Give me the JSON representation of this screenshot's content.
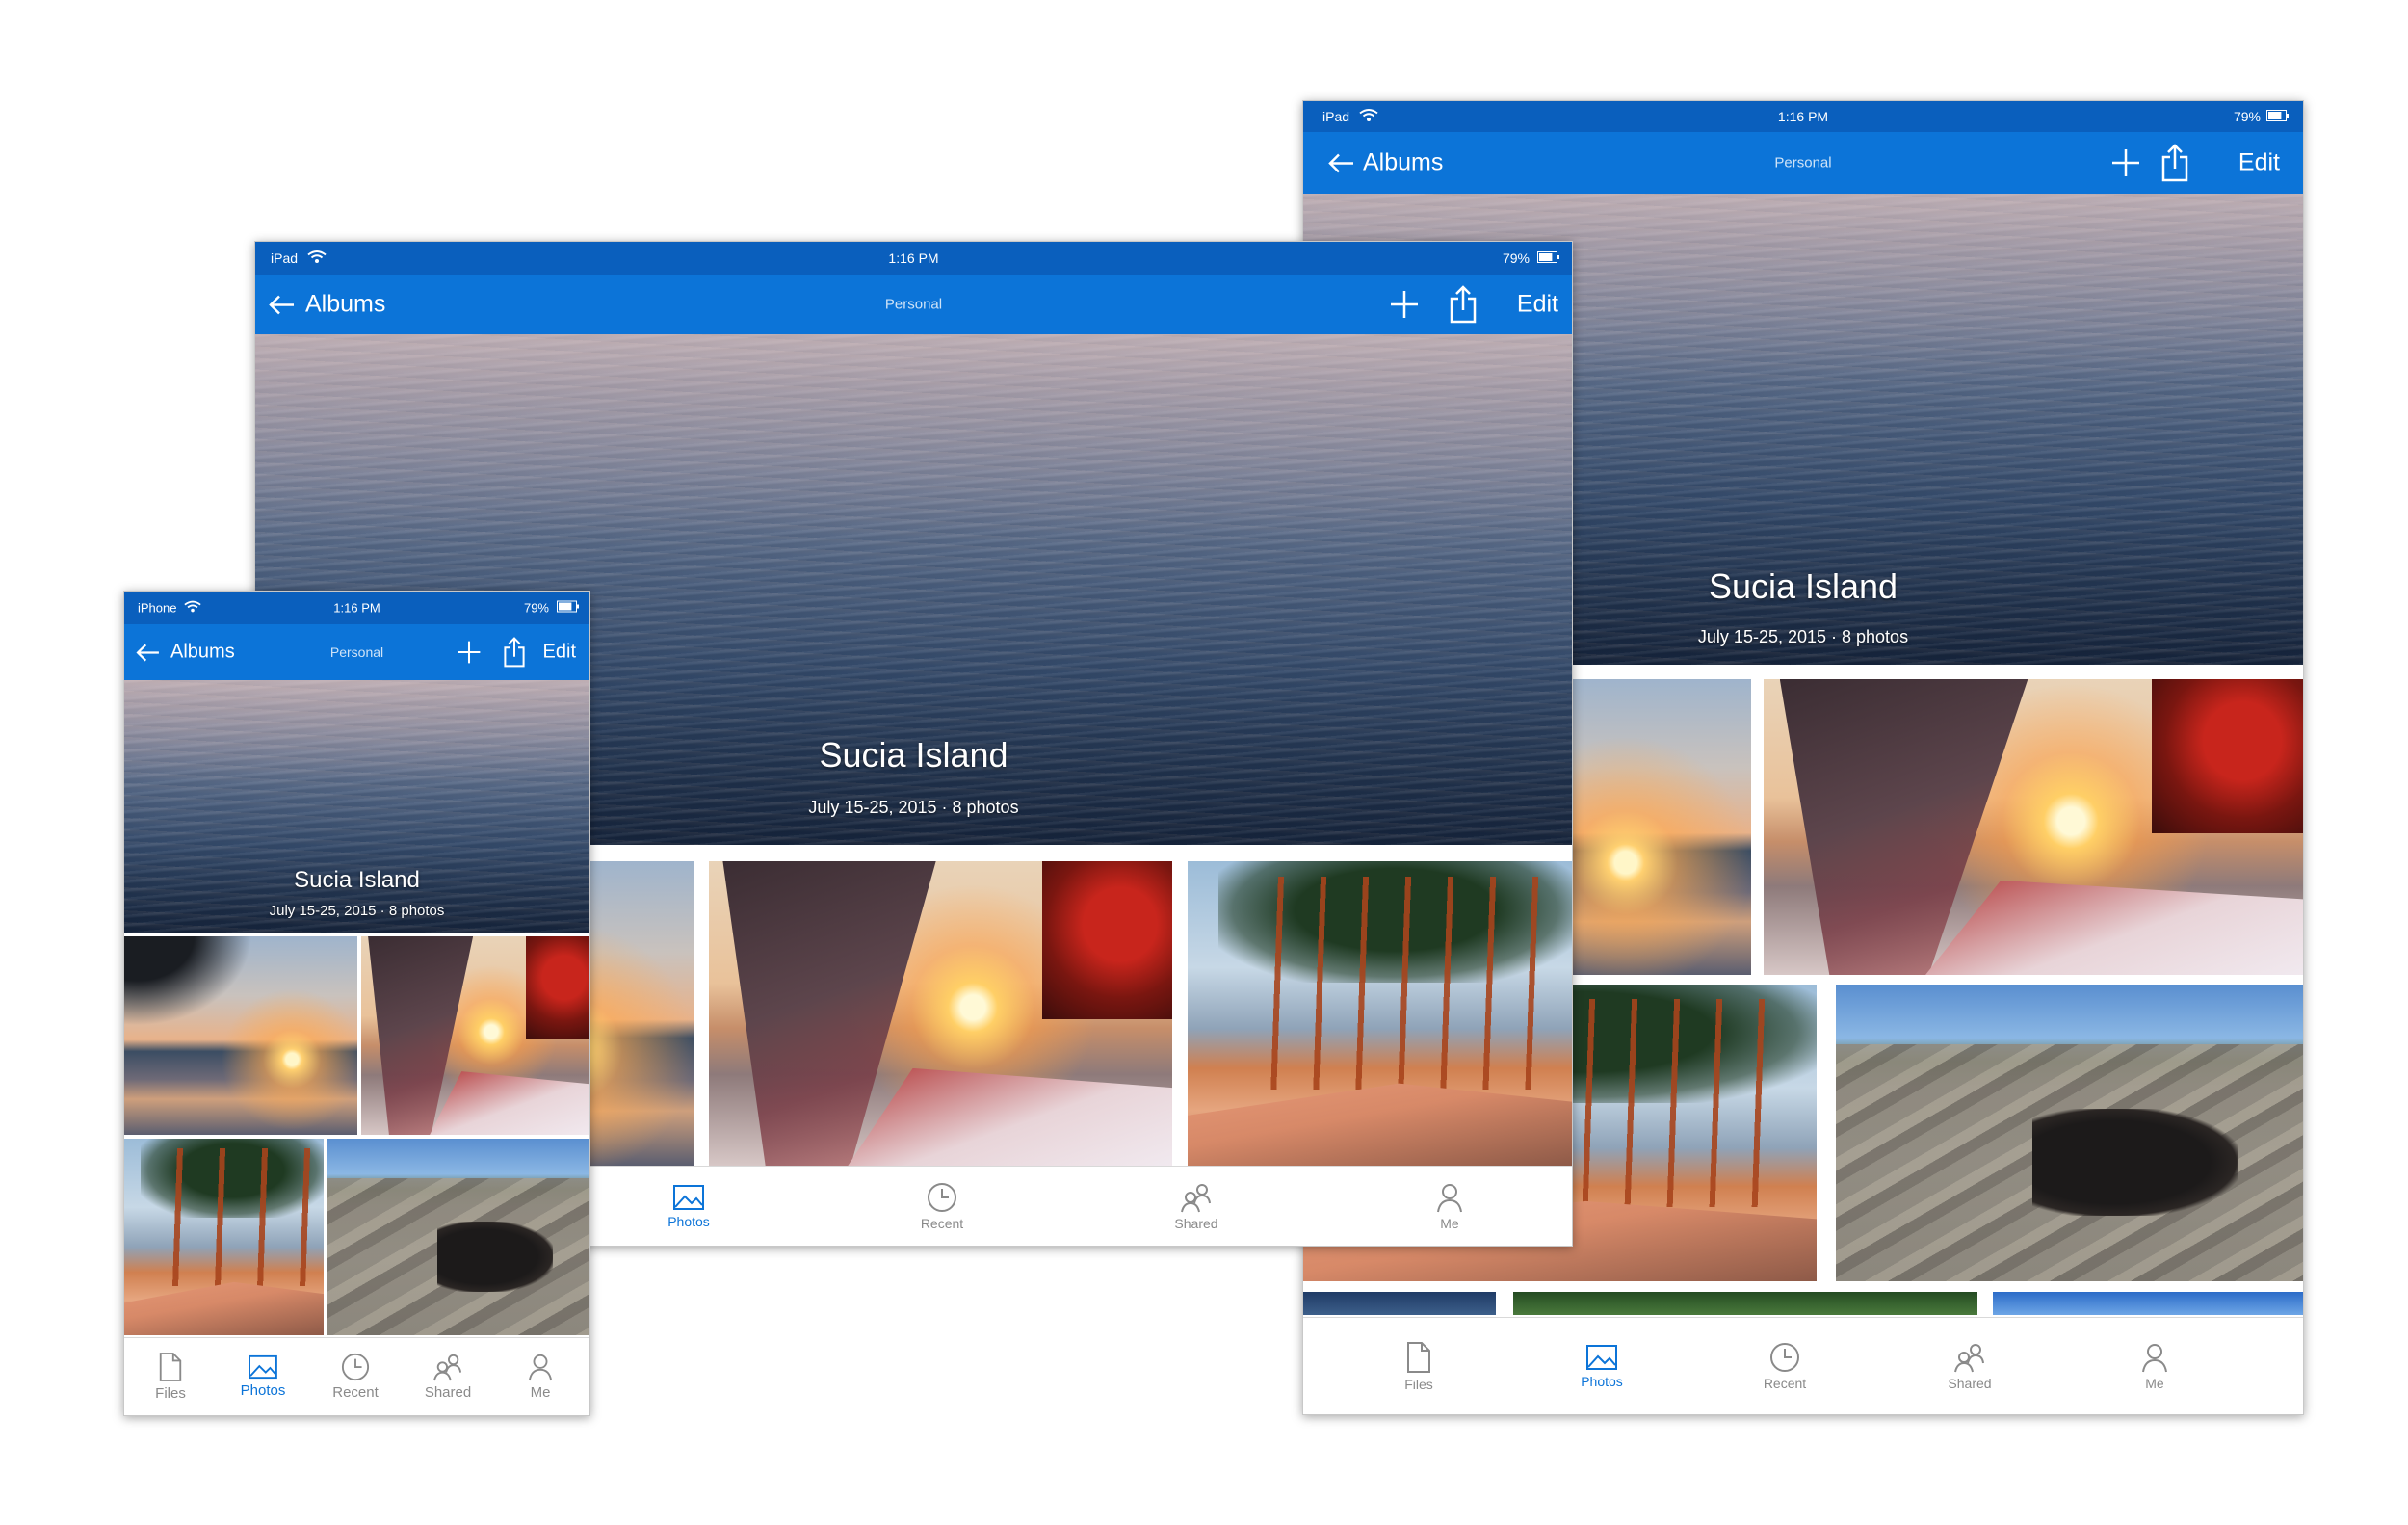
{
  "app": {
    "nav": {
      "back_label": "Albums",
      "center_label": "Personal",
      "edit_label": "Edit",
      "icons": [
        "back-arrow-icon",
        "plus-icon",
        "share-icon"
      ]
    },
    "album": {
      "title": "Sucia Island",
      "subtitle": "July 15-25, 2015 · 8 photos"
    },
    "status": {
      "time": "1:16 PM",
      "battery": "79%",
      "battery_level": 0.79
    },
    "colors": {
      "status_bar": "#0a5fbd",
      "nav_bar": "#0c74d8",
      "tab_active": "#0c74d8",
      "tab_inactive": "#8a8a8a"
    }
  },
  "devices": {
    "ipad_right": {
      "device_label": "iPad",
      "tabs": [
        {
          "label": "Files",
          "icon": "file-icon",
          "active": false
        },
        {
          "label": "Photos",
          "icon": "photo-icon",
          "active": true
        },
        {
          "label": "Recent",
          "icon": "clock-icon",
          "active": false
        },
        {
          "label": "Shared",
          "icon": "people-icon",
          "active": false
        },
        {
          "label": "Me",
          "icon": "person-icon",
          "active": false
        }
      ]
    },
    "ipad_middle": {
      "device_label": "iPad",
      "tabs": [
        {
          "label": "Photos",
          "icon": "photo-icon",
          "active": true
        },
        {
          "label": "Recent",
          "icon": "clock-icon",
          "active": false
        },
        {
          "label": "Shared",
          "icon": "people-icon",
          "active": false
        },
        {
          "label": "Me",
          "icon": "person-icon",
          "active": false
        }
      ]
    },
    "iphone": {
      "device_label": "iPhone",
      "tabs": [
        {
          "label": "Files",
          "icon": "file-icon",
          "active": false
        },
        {
          "label": "Photos",
          "icon": "photo-icon",
          "active": true
        },
        {
          "label": "Recent",
          "icon": "clock-icon",
          "active": false
        },
        {
          "label": "Shared",
          "icon": "people-icon",
          "active": false
        },
        {
          "label": "Me",
          "icon": "person-icon",
          "active": false
        }
      ]
    }
  }
}
